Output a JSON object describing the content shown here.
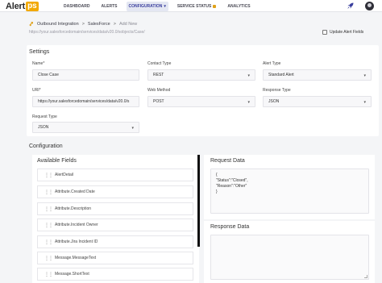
{
  "app": {
    "logo_text": "Alert",
    "logo_badge": "ps"
  },
  "nav": {
    "dashboard": "DASHBOARD",
    "alerts": "ALERTS",
    "configuration": "CONFIGURATION",
    "service_status": "SERVICE STATUS",
    "analytics": "ANALYTICS"
  },
  "breadcrumb": {
    "root": "Outbound Integration",
    "sep": ">",
    "parent": "SalesForce",
    "current": "Add New"
  },
  "endpoint_url": "https://your.salesforcedomain/services/data/v20.0/sobjects/Case/",
  "update_alert_fields": "Update Alert Fields",
  "settings": {
    "title": "Settings",
    "name": {
      "label": "Name*",
      "value": "Close Case"
    },
    "contact_type": {
      "label": "Contact Type",
      "value": "REST"
    },
    "alert_type": {
      "label": "Alert Type",
      "value": "Standard Alert"
    },
    "uri": {
      "label": "URI*",
      "value": "https://your.salesforcedomain/services/data/v20.0/s"
    },
    "web_method": {
      "label": "Web Method",
      "value": "POST"
    },
    "response_type": {
      "label": "Response Type",
      "value": "JSON"
    },
    "request_type": {
      "label": "Request Type",
      "value": "JSON"
    }
  },
  "configuration": {
    "title": "Configuration",
    "available_fields_title": "Available Fields",
    "available_fields": [
      "AlertDetail",
      "Attribute.Created Date",
      "Attribute.Description",
      "Attribute.Incident Owner",
      "Attribute.Jira Incident ID",
      "Message.MessageText",
      "Message.ShortText"
    ],
    "request_data_title": "Request Data",
    "request_data_body": "{\n\"Status\":\"Closed\",\n\"Reason\":\"Other\"\n}",
    "response_data_title": "Response Data"
  },
  "icons": {
    "rocket": "rocket-icon",
    "avatar": "user-avatar",
    "breadcrumb": "integration-icon",
    "dropdown": "chevron-down-icon",
    "drag": "drag-handle-icon",
    "lock": "lock-icon"
  },
  "colors": {
    "accent": "#3a3f9e",
    "brand_badge": "#f2a900"
  }
}
